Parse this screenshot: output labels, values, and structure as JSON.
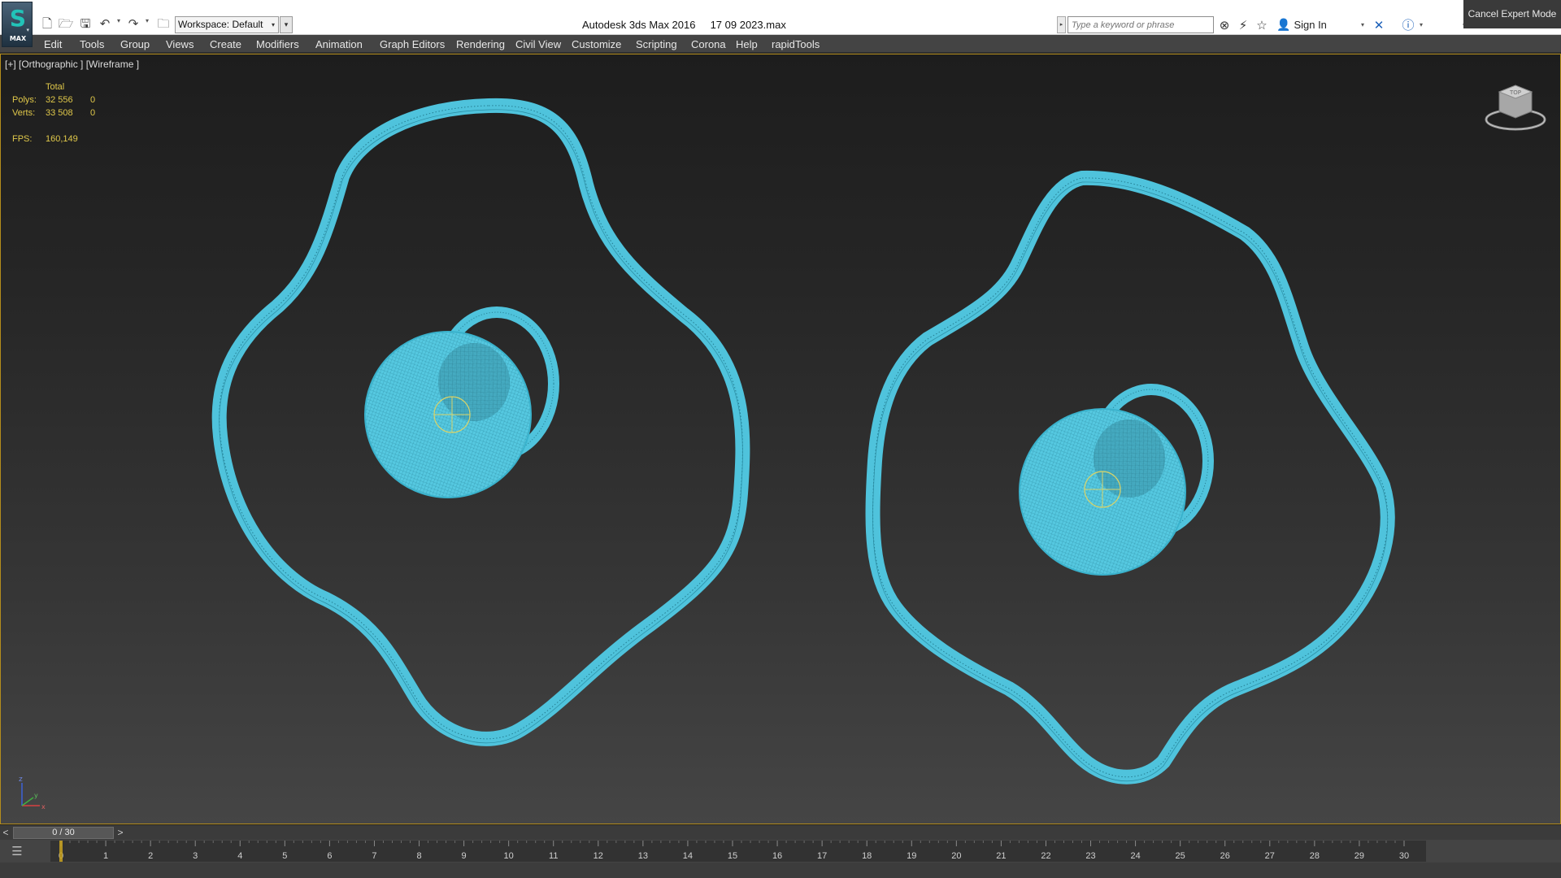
{
  "titlebar": {
    "app_title": "Autodesk 3ds Max 2016",
    "file_name": "17 09 2023.max",
    "logo_text": "MAX",
    "workspace": "Workspace: Default",
    "search_placeholder": "Type a keyword or phrase",
    "sign_in": "Sign In"
  },
  "menu": {
    "items": [
      "Edit",
      "Tools",
      "Group",
      "Views",
      "Create",
      "Modifiers",
      "Animation",
      "Graph Editors",
      "Rendering",
      "Civil View",
      "Customize",
      "Scripting",
      "Corona",
      "Help",
      "rapidTools"
    ]
  },
  "viewport": {
    "label": "[+] [Orthographic ] [Wireframe ]",
    "stats": {
      "total_header": "Total",
      "polys_label": "Polys:",
      "polys_total": "32 556",
      "polys_selected": "0",
      "verts_label": "Verts:",
      "verts_total": "33 508",
      "verts_selected": "0",
      "fps_label": "FPS:",
      "fps_value": "160,149"
    },
    "viewcube_label": "TOP",
    "wire_color": "#4fc3dc",
    "frame_color": "#b48d1c",
    "axis_labels": {
      "z": "z",
      "y": "y",
      "x": "x"
    }
  },
  "timeslider": {
    "prev": "<",
    "next": ">",
    "current": "0 / 30",
    "frame_start": 0,
    "frame_end": 30,
    "frame_current": 0
  },
  "trackbar": {
    "ticks": [
      "0",
      "1",
      "2",
      "3",
      "4",
      "5",
      "6",
      "7",
      "8",
      "9",
      "10",
      "11",
      "12",
      "13",
      "14",
      "15",
      "16",
      "17",
      "18",
      "19",
      "20",
      "21",
      "22",
      "23",
      "24",
      "25",
      "26",
      "27",
      "28",
      "29",
      "30"
    ]
  },
  "status": {
    "cancel_expert_mode": "Cancel Expert Mode"
  },
  "icons": {
    "new": "new-file-icon",
    "open": "open-file-icon",
    "save": "save-icon",
    "undo": "undo-icon",
    "redo": "redo-icon",
    "project": "project-folder-icon",
    "binoculars": "binoculars-icon",
    "subscription": "subscription-icon",
    "favorites": "star-icon",
    "exchange": "exchange-x-icon",
    "help": "help-icon",
    "minimize": "minimize-icon",
    "restore": "restore-icon",
    "close": "close-icon"
  }
}
